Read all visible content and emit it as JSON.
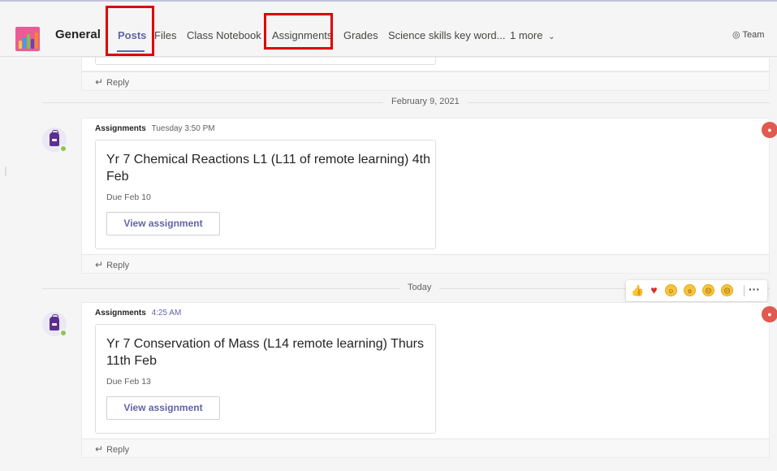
{
  "header": {
    "team_name": "General",
    "tabs": [
      {
        "label": "Posts",
        "active": true
      },
      {
        "label": "Files",
        "active": false
      },
      {
        "label": "Class Notebook",
        "active": false
      },
      {
        "label": "Assignments",
        "active": false
      },
      {
        "label": "Grades",
        "active": false
      },
      {
        "label": "Science skills key word...",
        "active": false
      },
      {
        "label": "1 more",
        "active": false
      }
    ],
    "team_button": "Team",
    "highlight_color": "#e00000",
    "accent_color": "#6264a7"
  },
  "reply_label": "Reply",
  "separators": {
    "first": "February 9, 2021",
    "second": "Today"
  },
  "posts": [
    {
      "author": "Assignments",
      "time": "Tuesday 3:50 PM",
      "title": "Yr 7 Chemical Reactions L1 (L11 of remote learning) 4th Feb",
      "due": "Due Feb 10",
      "button": "View assignment"
    },
    {
      "author": "Assignments",
      "time": "4:25 AM",
      "title": "Yr 7 Conservation of Mass (L14 remote learning) Thurs 11th Feb",
      "due": "Due Feb 13",
      "button": "View assignment"
    }
  ],
  "icons": {
    "reply": "reply-arrow-icon",
    "chevron": "chevron-down-icon",
    "eye": "eye-icon",
    "reactions": [
      "like-icon",
      "heart-icon",
      "laugh-icon",
      "surprised-icon",
      "sad-icon",
      "angry-icon",
      "more-options-icon"
    ]
  }
}
